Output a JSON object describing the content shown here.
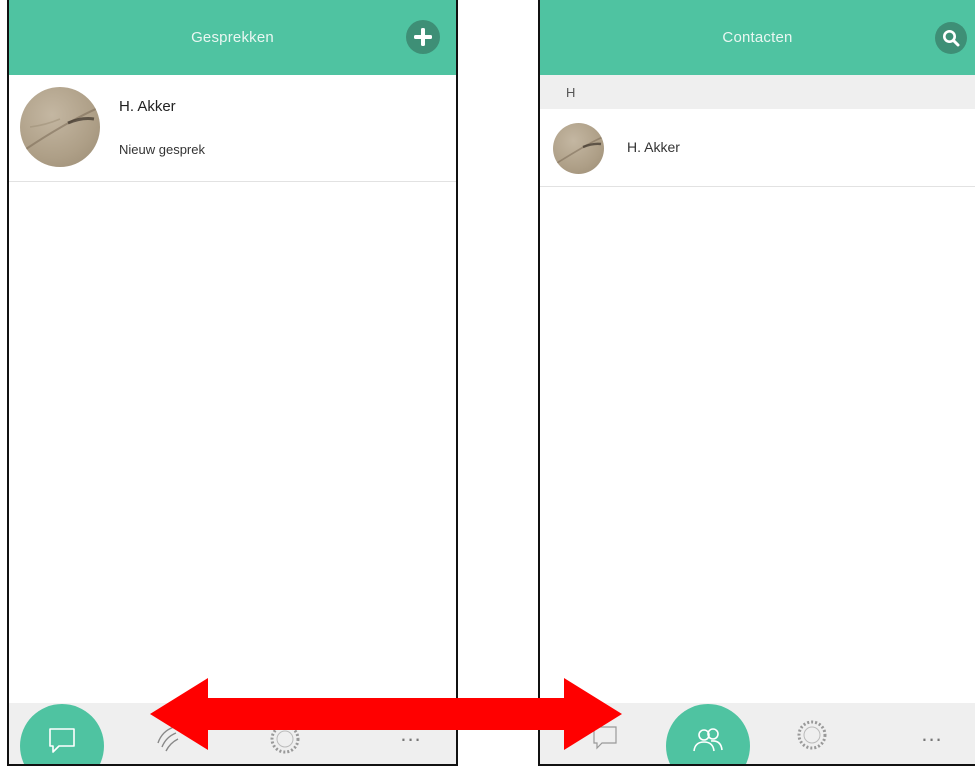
{
  "left_screen": {
    "header": {
      "title": "Gesprekken",
      "action_icon": "plus-icon"
    },
    "conversations": [
      {
        "name": "H. Akker",
        "subtitle": "Nieuw gesprek"
      }
    ],
    "tabbar": {
      "active_icon": "chat-bubble-icon",
      "icons": [
        "chat-bubble-icon",
        "signal-icon",
        "seal-icon",
        "more-dots-icon"
      ],
      "more_label": "..."
    }
  },
  "right_screen": {
    "header": {
      "title": "Contacten",
      "action_icon": "search-icon"
    },
    "sections": [
      {
        "letter": "H",
        "contacts": [
          {
            "name": "H. Akker"
          }
        ]
      }
    ],
    "tabbar": {
      "active_icon": "contacts-icon",
      "icons": [
        "chat-bubble-icon",
        "contacts-icon",
        "seal-icon",
        "more-dots-icon"
      ],
      "more_label": "..."
    }
  },
  "overlay": {
    "arrow_icon": "double-arrow-icon",
    "arrow_color": "#ff0000"
  },
  "colors": {
    "accent": "#4fc3a1",
    "accent_dark": "#3e8f76",
    "tabbar_bg": "#efefef"
  }
}
